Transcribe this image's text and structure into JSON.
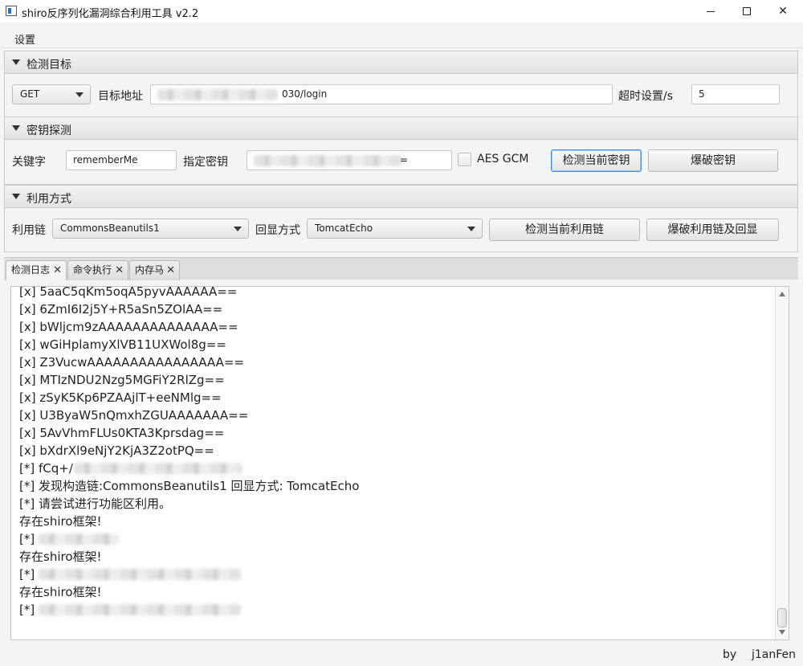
{
  "window": {
    "title": "shiro反序列化漏洞综合利用工具 v2.2"
  },
  "menu": {
    "settings": "设置"
  },
  "detect_target": {
    "header": "检测目标",
    "method": "GET",
    "url_label": "目标地址",
    "url_value": "030/login",
    "timeout_label": "超时设置/s",
    "timeout_value": "5"
  },
  "key_detect": {
    "header": "密钥探测",
    "keyword_label": "关键字",
    "keyword_value": "rememberMe",
    "key_label": "指定密钥",
    "key_value": "=",
    "aes_gcm_label": "AES GCM",
    "check_key_button": "检测当前密钥",
    "brute_key_button": "爆破密钥"
  },
  "exploit": {
    "header": "利用方式",
    "chain_label": "利用链",
    "chain_value": "CommonsBeanutils1",
    "echo_label": "回显方式",
    "echo_value": "TomcatEcho",
    "check_chain_button": "检测当前利用链",
    "brute_chain_button": "爆破利用链及回显"
  },
  "tabs": [
    {
      "label": "检测日志",
      "close": "✕"
    },
    {
      "label": "命令执行",
      "close": "✕"
    },
    {
      "label": "内存马",
      "close": "✕"
    }
  ],
  "log": [
    "[x] 5aaC5qKm5oqA5pyvAAAAAA==",
    "[x] 6ZmI6I2j5Y+R5aSn5ZOlAA==",
    "[x] bWljcm9zAAAAAAAAAAAAAA==",
    "[x] wGiHplamyXlVB11UXWol8g==",
    "[x] Z3VucwAAAAAAAAAAAAAAAA==",
    "[x] MTIzNDU2Nzg5MGFiY2RlZg==",
    "[x] zSyK5Kp6PZAAjlT+eeNMlg==",
    "[x] U3ByaW5nQmxhZGUAAAAAAA==",
    "[x] 5AvVhmFLUs0KTA3Kprsdag==",
    "[x] bXdrXl9eNjY2KjA3Z2otPQ==",
    "[*] fCq+/",
    "[*] 发现构造链:CommonsBeanutils1  回显方式: TomcatEcho",
    "[*] 请尝试进行功能区利用。",
    "存在shiro框架!",
    "[*]",
    "存在shiro框架!",
    "[*]",
    "存在shiro框架!",
    "[*]"
  ],
  "footer": {
    "by": "by",
    "author": "j1anFen"
  }
}
